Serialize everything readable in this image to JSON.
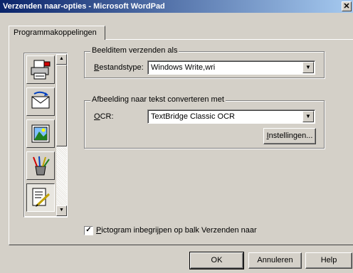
{
  "window": {
    "title": "Verzenden naar-opties - Microsoft WordPad",
    "close_glyph": "✕"
  },
  "tabs": [
    {
      "label": "Programmakoppelingen",
      "selected": true
    }
  ],
  "icon_list": {
    "items": [
      {
        "name": "print-fax-icon"
      },
      {
        "name": "send-mail-icon"
      },
      {
        "name": "image-icon"
      },
      {
        "name": "paint-brushes-icon"
      },
      {
        "name": "document-edit-icon",
        "selected": true
      }
    ],
    "scroll_up_glyph": "▲",
    "scroll_down_glyph": "▼"
  },
  "send_group": {
    "legend": "Beelditem verzenden als",
    "filetype_label_ul": "B",
    "filetype_label_rest": "estandstype:",
    "filetype_value": "Windows Write,wri"
  },
  "ocr_group": {
    "legend": "Afbeelding naar tekst converteren met",
    "ocr_label_ul": "O",
    "ocr_label_rest": "CR:",
    "ocr_value": "TextBridge Classic OCR",
    "settings_ul": "I",
    "settings_rest": "nstellingen..."
  },
  "checkbox": {
    "checked": true,
    "check_glyph": "✓",
    "label_ul": "P",
    "label_rest": "ictogram inbegrijpen op balk Verzenden naar"
  },
  "buttons": {
    "ok": "OK",
    "cancel": "Annuleren",
    "help": "Help"
  },
  "combo_arrow_glyph": "▼"
}
